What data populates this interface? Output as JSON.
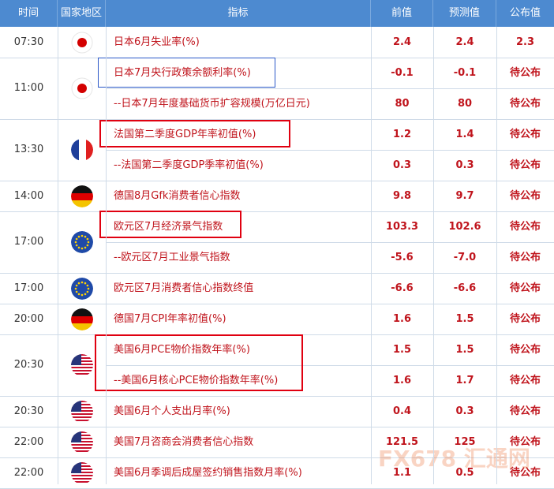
{
  "headers": {
    "time": "时间",
    "region": "国家地区",
    "indicator": "指标",
    "previous": "前值",
    "forecast": "预测值",
    "published": "公布值"
  },
  "groups": [
    {
      "time": "07:30",
      "flag": "japan-flag-icon",
      "rows": [
        {
          "indicator": "日本6月失业率(%)",
          "previous": "2.4",
          "forecast": "2.4",
          "published": "2.3"
        }
      ]
    },
    {
      "time": "11:00",
      "flag": "japan-flag-icon",
      "rows": [
        {
          "indicator": "日本7月央行政策余额利率(%)",
          "previous": "-0.1",
          "forecast": "-0.1",
          "published": "待公布"
        },
        {
          "indicator": "--日本7月年度基础货币扩容规模(万亿日元)",
          "previous": "80",
          "forecast": "80",
          "published": "待公布"
        }
      ]
    },
    {
      "time": "13:30",
      "flag": "france-flag-icon",
      "rows": [
        {
          "indicator": "法国第二季度GDP年率初值(%)",
          "previous": "1.2",
          "forecast": "1.4",
          "published": "待公布"
        },
        {
          "indicator": "--法国第二季度GDP季率初值(%)",
          "previous": "0.3",
          "forecast": "0.3",
          "published": "待公布"
        }
      ]
    },
    {
      "time": "14:00",
      "flag": "germany-flag-icon",
      "rows": [
        {
          "indicator": "德国8月Gfk消费者信心指数",
          "previous": "9.8",
          "forecast": "9.7",
          "published": "待公布"
        }
      ]
    },
    {
      "time": "17:00",
      "flag": "eu-flag-icon",
      "rows": [
        {
          "indicator": "欧元区7月经济景气指数",
          "previous": "103.3",
          "forecast": "102.6",
          "published": "待公布"
        },
        {
          "indicator": "--欧元区7月工业景气指数",
          "previous": "-5.6",
          "forecast": "-7.0",
          "published": "待公布"
        }
      ]
    },
    {
      "time": "17:00",
      "flag": "eu-flag-icon",
      "rows": [
        {
          "indicator": "欧元区7月消费者信心指数终值",
          "previous": "-6.6",
          "forecast": "-6.6",
          "published": "待公布"
        }
      ]
    },
    {
      "time": "20:00",
      "flag": "germany-flag-icon",
      "rows": [
        {
          "indicator": "德国7月CPI年率初值(%)",
          "previous": "1.6",
          "forecast": "1.5",
          "published": "待公布"
        }
      ]
    },
    {
      "time": "20:30",
      "flag": "usa-flag-icon",
      "rows": [
        {
          "indicator": "美国6月PCE物价指数年率(%)",
          "previous": "1.5",
          "forecast": "1.5",
          "published": "待公布"
        },
        {
          "indicator": "--美国6月核心PCE物价指数年率(%)",
          "previous": "1.6",
          "forecast": "1.7",
          "published": "待公布"
        }
      ]
    },
    {
      "time": "20:30",
      "flag": "usa-flag-icon",
      "rows": [
        {
          "indicator": "美国6月个人支出月率(%)",
          "previous": "0.4",
          "forecast": "0.3",
          "published": "待公布"
        }
      ]
    },
    {
      "time": "22:00",
      "flag": "usa-flag-icon",
      "rows": [
        {
          "indicator": "美国7月咨商会消费者信心指数",
          "previous": "121.5",
          "forecast": "125",
          "published": "待公布"
        }
      ]
    },
    {
      "time": "22:00",
      "flag": "usa-flag-icon",
      "rows": [
        {
          "indicator": "美国6月季调后成屋签约销售指数月率(%)",
          "previous": "1.1",
          "forecast": "0.5",
          "published": "待公布"
        }
      ]
    }
  ],
  "watermark": "FX678 汇通网",
  "colors": {
    "header": "#4d8ad0",
    "text_red": "#c0141c",
    "highlight_box": "#e00010",
    "selection_box": "#2b58c8"
  }
}
